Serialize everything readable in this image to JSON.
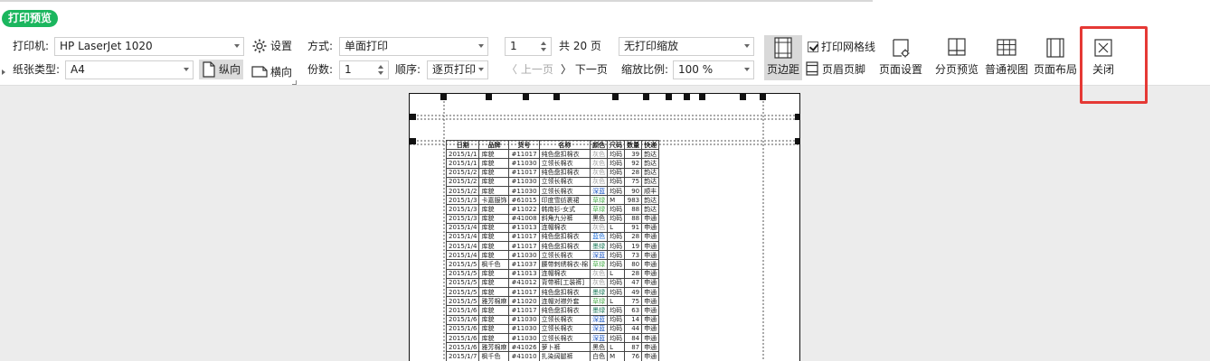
{
  "tab": "打印预览",
  "printer": {
    "label": "打印机:",
    "value": "HP LaserJet 1020"
  },
  "settings_label": "设置",
  "paper": {
    "label": "纸张类型:",
    "value": "A4"
  },
  "orientation": {
    "portrait": "纵向",
    "landscape": "横向"
  },
  "mode": {
    "label": "方式:",
    "value": "单面打印"
  },
  "copies": {
    "label": "份数:",
    "value": "1"
  },
  "order": {
    "label": "顺序:",
    "value": "逐页打印"
  },
  "page": {
    "value": "1",
    "total_label": "共 20 页"
  },
  "nav": {
    "prev": "上一页",
    "next": "下一页"
  },
  "scaling": {
    "value": "无打印缩放"
  },
  "zoom": {
    "label": "缩放比例:",
    "value": "100 %"
  },
  "buttons": {
    "margins": "页边距",
    "gridlines": "打印网格线",
    "header_footer": "页眉页脚",
    "page_setup": "页面设置",
    "page_break_preview": "分页预览",
    "normal_view": "普通视图",
    "page_layout": "页面布局",
    "close": "关闭"
  },
  "sheet": {
    "headers": [
      "日期",
      "品牌",
      "货号",
      "名称",
      "颜色",
      "尺码",
      "数量",
      "快递"
    ],
    "rows": [
      [
        "2015/1/1",
        "库貌",
        "#11017",
        "纯色盘扣棉衣",
        "灰色",
        "均码",
        "39",
        "韵达"
      ],
      [
        "2015/1/1",
        "库貌",
        "#11030",
        "立领长棉衣",
        "灰色",
        "均码",
        "92",
        "韵达"
      ],
      [
        "2015/1/2",
        "库貌",
        "#11017",
        "纯色盘扣棉衣",
        "灰色",
        "均码",
        "28",
        "韵达"
      ],
      [
        "2015/1/2",
        "库貌",
        "#11030",
        "立领长棉衣",
        "灰色",
        "均码",
        "75",
        "韵达"
      ],
      [
        "2015/1/2",
        "库貌",
        "#11030",
        "立领长棉衣",
        "深蓝",
        "均码",
        "90",
        "顺丰"
      ],
      [
        "2015/1/3",
        "卡嘉服饰",
        "#61015",
        "印度雪纺裹裙",
        "草绿",
        "M",
        "983",
        "韵达"
      ],
      [
        "2015/1/3",
        "库貌",
        "#11022",
        "韩南衫-女式",
        "草绿",
        "均码",
        "88",
        "韵达"
      ],
      [
        "2015/1/3",
        "库貌",
        "#41008",
        "斜角九分裤",
        "黑色",
        "均码",
        "88",
        "申通"
      ],
      [
        "2015/1/4",
        "库貌",
        "#11013",
        "连帽棉衣",
        "灰色",
        "L",
        "91",
        "申通"
      ],
      [
        "2015/1/4",
        "库貌",
        "#11017",
        "纯色盘扣棉衣",
        "蓝色",
        "均码",
        "28",
        "申通"
      ],
      [
        "2015/1/4",
        "库貌",
        "#11017",
        "纯色盘扣棉衣",
        "墨绿",
        "均码",
        "19",
        "申通"
      ],
      [
        "2015/1/4",
        "库貌",
        "#11030",
        "立领长棉衣",
        "深蓝",
        "均码",
        "73",
        "申通"
      ],
      [
        "2015/1/5",
        "枫千色",
        "#11037",
        "腰带刺绣棉衣-棉",
        "草绿",
        "均码",
        "80",
        "申通"
      ],
      [
        "2015/1/5",
        "库貌",
        "#11013",
        "连帽棉衣",
        "灰色",
        "L",
        "28",
        "申通"
      ],
      [
        "2015/1/5",
        "库貌",
        "#41012",
        "背带裤[工装裤]",
        "灰色",
        "均码",
        "47",
        "申通"
      ],
      [
        "2015/1/5",
        "库貌",
        "#11017",
        "纯色盘扣棉衣",
        "墨绿",
        "均码",
        "49",
        "申通"
      ],
      [
        "2015/1/5",
        "雅芳棉麻",
        "#11020",
        "连帽对襟外套",
        "草绿",
        "L",
        "75",
        "申通"
      ],
      [
        "2015/1/6",
        "库貌",
        "#11017",
        "纯色盘扣棉衣",
        "墨绿",
        "均码",
        "63",
        "申通"
      ],
      [
        "2015/1/6",
        "库貌",
        "#11030",
        "立领长棉衣",
        "深蓝",
        "均码",
        "14",
        "申通"
      ],
      [
        "2015/1/6",
        "库貌",
        "#11030",
        "立领长棉衣",
        "深蓝",
        "均码",
        "44",
        "申通"
      ],
      [
        "2015/1/6",
        "库貌",
        "#11030",
        "立领长棉衣",
        "深蓝",
        "均码",
        "84",
        "申通"
      ],
      [
        "2015/1/6",
        "雅芳棉麻",
        "#41026",
        "萝卜裤",
        "黑色",
        "L",
        "87",
        "申通"
      ],
      [
        "2015/1/7",
        "枫千色",
        "#41010",
        "扎染阔腿裤",
        "白色",
        "M",
        "76",
        "申通"
      ]
    ]
  },
  "colors": {
    "tab_green": "#1bb65e",
    "highlight_red": "#e53935",
    "color_cells": {
      "灰色": "#9e9e9e",
      "深蓝": "#1a56c4",
      "草绿": "#4caf50",
      "蓝色": "#1e6fd9",
      "墨绿": "#1b7a5a",
      "黑色": "#222222",
      "白色": "#222222"
    }
  }
}
